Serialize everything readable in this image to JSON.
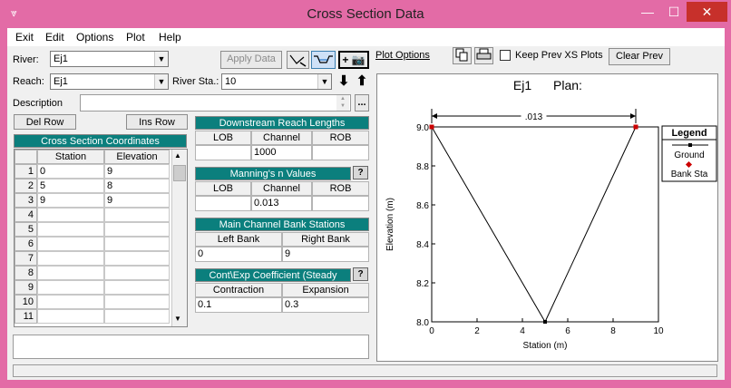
{
  "window": {
    "title": "Cross Section Data",
    "minimize_glyph": "—",
    "maximize_glyph": "☐",
    "close_glyph": "✕",
    "system_icon_glyph": "⩔"
  },
  "menu": [
    "Exit",
    "Edit",
    "Options",
    "Plot",
    "Help"
  ],
  "river": {
    "label": "River:",
    "value": "Ej1"
  },
  "reach": {
    "label": "Reach:",
    "value": "Ej1"
  },
  "river_sta": {
    "label": "River Sta.:",
    "value": "10"
  },
  "toolbar": {
    "apply_data": "Apply Data",
    "plot_options": "Plot Options",
    "keep_prev": "Keep Prev XS Plots",
    "clear_prev": "Clear Prev",
    "more_button": "...",
    "down_arrow": "⬇",
    "up_arrow": "⬆",
    "plus_camera": "+ 📷"
  },
  "description_label": "Description",
  "del_row": "Del Row",
  "ins_row": "Ins Row",
  "coords": {
    "title": "Cross Section Coordinates",
    "col_station": "Station",
    "col_elevation": "Elevation",
    "rows": [
      {
        "n": "1",
        "station": "0",
        "elevation": "9"
      },
      {
        "n": "2",
        "station": "5",
        "elevation": "8"
      },
      {
        "n": "3",
        "station": "9",
        "elevation": "9"
      },
      {
        "n": "4",
        "station": "",
        "elevation": ""
      },
      {
        "n": "5",
        "station": "",
        "elevation": ""
      },
      {
        "n": "6",
        "station": "",
        "elevation": ""
      },
      {
        "n": "7",
        "station": "",
        "elevation": ""
      },
      {
        "n": "8",
        "station": "",
        "elevation": ""
      },
      {
        "n": "9",
        "station": "",
        "elevation": ""
      },
      {
        "n": "10",
        "station": "",
        "elevation": ""
      },
      {
        "n": "11",
        "station": "",
        "elevation": ""
      }
    ]
  },
  "downstream": {
    "title": "Downstream Reach Lengths",
    "lob": "LOB",
    "channel": "Channel",
    "rob": "ROB",
    "lob_val": "",
    "channel_val": "1000",
    "rob_val": ""
  },
  "mannings": {
    "title": "Manning's n Values",
    "lob": "LOB",
    "channel": "Channel",
    "rob": "ROB",
    "lob_val": "",
    "channel_val": "0.013",
    "rob_val": ""
  },
  "bank": {
    "title": "Main Channel Bank Stations",
    "left": "Left Bank",
    "right": "Right Bank",
    "left_val": "0",
    "right_val": "9"
  },
  "cont": {
    "title": "Cont\\Exp Coefficient (Steady",
    "contraction": "Contraction",
    "expansion": "Expansion",
    "contraction_val": "0.1",
    "expansion_val": "0.3"
  },
  "help_glyph": "?",
  "chart_data": {
    "type": "line",
    "title_left": "Ej1",
    "title_right": "Plan:",
    "xlabel": "Station (m)",
    "ylabel": "Elevation (m)",
    "xlim": [
      0,
      10
    ],
    "ylim": [
      8.0,
      9.0
    ],
    "x_ticks": [
      0,
      2,
      4,
      6,
      8,
      10
    ],
    "x_tick_labels": [
      "0",
      "2",
      "4",
      "6",
      "8",
      "10"
    ],
    "y_ticks": [
      8.0,
      8.2,
      8.4,
      8.6,
      8.8,
      9.0
    ],
    "y_tick_labels": [
      "8.0",
      "8.2",
      "8.4",
      "8.6",
      "8.8",
      "9.0"
    ],
    "series": [
      {
        "name": "Ground",
        "x": [
          0,
          5,
          9
        ],
        "y": [
          9,
          8,
          9
        ],
        "color": "#000000"
      },
      {
        "name": "Bank Sta",
        "x": [
          0,
          9
        ],
        "y": [
          9,
          9
        ],
        "color": "#cc0000"
      }
    ],
    "annotation": {
      "label": ".013",
      "x_from": 0,
      "x_to": 9,
      "y": 9.0
    },
    "legend": {
      "title": "Legend",
      "position": "right"
    }
  },
  "colors": {
    "accent": "#0b7f7d",
    "titlebar": "#e36ba6",
    "close": "#c7302b"
  }
}
